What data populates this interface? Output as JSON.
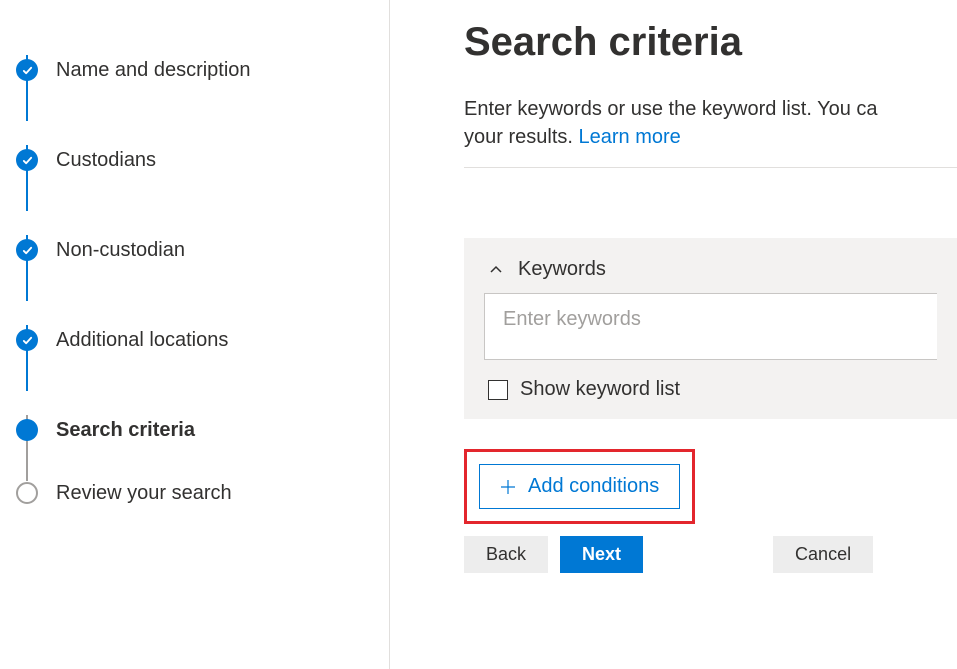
{
  "sidebar": {
    "steps": [
      {
        "label": "Name and description",
        "state": "completed"
      },
      {
        "label": "Custodians",
        "state": "completed"
      },
      {
        "label": "Non-custodian",
        "state": "completed"
      },
      {
        "label": "Additional locations",
        "state": "completed"
      },
      {
        "label": "Search criteria",
        "state": "current"
      },
      {
        "label": "Review your search",
        "state": "pending"
      }
    ]
  },
  "main": {
    "title": "Search criteria",
    "description_pre": "Enter keywords or use the keyword list. You ca",
    "description_post": "your results. ",
    "learn_more": "Learn more",
    "keywords_header": "Keywords",
    "keywords_placeholder": "Enter keywords",
    "show_keyword_list": "Show keyword list",
    "add_conditions": "Add conditions"
  },
  "buttons": {
    "back": "Back",
    "next": "Next",
    "cancel": "Cancel"
  }
}
